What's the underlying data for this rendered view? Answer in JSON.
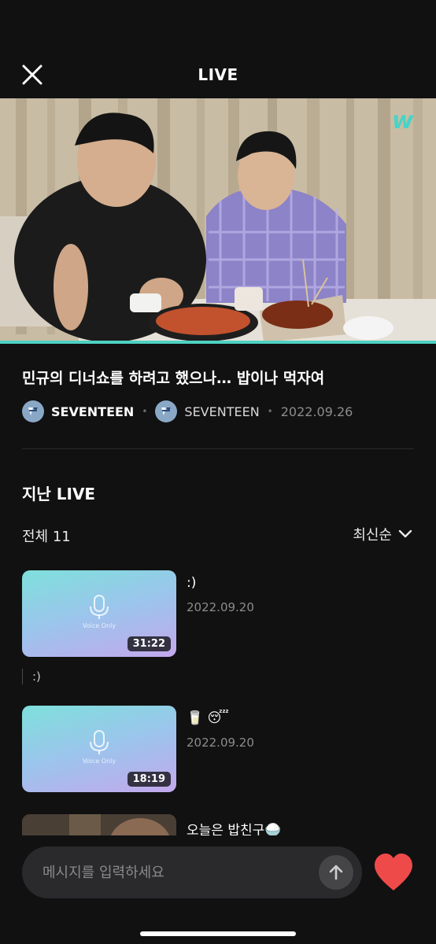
{
  "header": {
    "title": "LIVE"
  },
  "video": {
    "progress": 1.0,
    "logo_icon": "weverse-w-logo-icon",
    "accent": "#4fd1c2"
  },
  "live": {
    "title": "민규의 디너쇼를 하려고 했으나… 밥이나 먹자여",
    "artist": "SEVENTEEN",
    "community": "SEVENTEEN",
    "date": "2022.09.26"
  },
  "past": {
    "section_title": "지난 LIVE",
    "count_label": "전체 11",
    "sort_label": "최신순",
    "voice_label": "Voice Only",
    "items": [
      {
        "title": ":)",
        "date": "2022.09.20",
        "duration": "31:22",
        "description": ":)"
      },
      {
        "title": "🥛 😴",
        "date": "2022.09.20",
        "duration": "18:19"
      },
      {
        "title": "오늘은 밥친구🍚"
      }
    ]
  },
  "composer": {
    "placeholder": "메시지를 입력하세요"
  },
  "colors": {
    "background": "#111112",
    "heart": "#ef4a4a",
    "progress": "#4fd1c2"
  }
}
